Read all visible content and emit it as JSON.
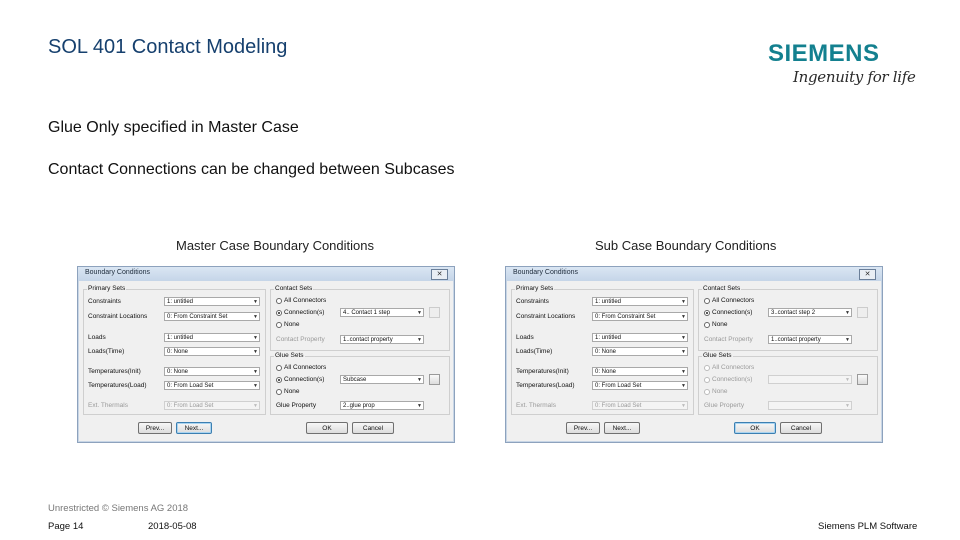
{
  "slide": {
    "title": "SOL 401 Contact Modeling",
    "bullets": [
      "Glue Only specified in Master Case",
      "Contact Connections can be changed between Subcases"
    ],
    "caption_left": "Master Case Boundary Conditions",
    "caption_right": "Sub Case Boundary Conditions"
  },
  "logo": {
    "wordmark": "SIEMENS",
    "tagline": "Ingenuity for life",
    "color": "#13808f"
  },
  "dialogs": [
    {
      "title": "Boundary Conditions",
      "close": "✕",
      "primary_sets_label": "Primary Sets",
      "rows": [
        {
          "label": "Constraints",
          "value": "1: untitled"
        },
        {
          "label": "Constraint Locations",
          "value": "0: From Constraint Set"
        },
        {
          "label": "Loads",
          "value": "1: untitled"
        },
        {
          "label": "Loads(Time)",
          "value": "0: None"
        },
        {
          "label": "Temperatures(Init)",
          "value": "0: None"
        },
        {
          "label": "Temperatures(Load)",
          "value": "0: From Load Set"
        },
        {
          "label": "Ext. Thermals",
          "value": "0: From Load Set"
        }
      ],
      "contact_sets_label": "Contact Sets",
      "contact_all": "All Connectors",
      "contact_conn": "Connection(s)",
      "contact_none": "None",
      "contact_value": "4.. Contact 1 step",
      "contact_property_label": "Contact Property",
      "contact_property_value": "1..contact property",
      "glue_sets_label": "Glue Sets",
      "glue_all": "All Connectors",
      "glue_conn": "Connection(s)",
      "glue_none": "None",
      "glue_value": "Subcase",
      "glue_property_label": "Glue Property",
      "glue_property_value": "2..glue prop",
      "prev": "Prev...",
      "next": "Next...",
      "ok": "OK",
      "cancel": "Cancel"
    },
    {
      "title": "Boundary Conditions",
      "close": "✕",
      "primary_sets_label": "Primary Sets",
      "rows": [
        {
          "label": "Constraints",
          "value": "1: untitled"
        },
        {
          "label": "Constraint Locations",
          "value": "0: From Constraint Set"
        },
        {
          "label": "Loads",
          "value": "1: untitled"
        },
        {
          "label": "Loads(Time)",
          "value": "0: None"
        },
        {
          "label": "Temperatures(Init)",
          "value": "0: None"
        },
        {
          "label": "Temperatures(Load)",
          "value": "0: From Load Set"
        },
        {
          "label": "Ext. Thermals",
          "value": "0: From Load Set"
        }
      ],
      "contact_sets_label": "Contact Sets",
      "contact_all": "All Connectors",
      "contact_conn": "Connection(s)",
      "contact_none": "None",
      "contact_value": "3..contact step 2",
      "contact_property_label": "Contact Property",
      "contact_property_value": "1..contact property",
      "glue_sets_label": "Glue Sets",
      "glue_all": "All Connectors",
      "glue_conn": "Connection(s)",
      "glue_none": "None",
      "glue_value": "",
      "glue_property_label": "Glue Property",
      "glue_property_value": "",
      "prev": "Prev...",
      "next": "Next...",
      "ok": "OK",
      "cancel": "Cancel"
    }
  ],
  "footer": {
    "classification": "Unrestricted © Siemens AG 2018",
    "page": "Page 14",
    "date": "2018-05-08",
    "company": "Siemens PLM Software"
  }
}
